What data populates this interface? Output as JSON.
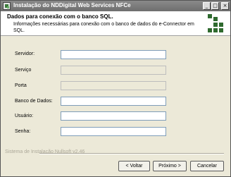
{
  "window": {
    "title": "Instalação do NDDigital Web Services NFCe",
    "controls": {
      "minimize": "_",
      "maximize": "□",
      "close": "×"
    }
  },
  "header": {
    "title": "Dados para conexão com o banco SQL.",
    "subtitle": "Informações necessárias para conexão com o banco de dados do e-Connector em SQL."
  },
  "form": {
    "fields": [
      {
        "label": "Servidor:",
        "value": "",
        "enabled": true
      },
      {
        "label": "Serviço",
        "value": "",
        "enabled": false
      },
      {
        "label": "Porta",
        "value": "",
        "enabled": false
      },
      {
        "label": "Banco de Dados:",
        "value": "",
        "enabled": true
      },
      {
        "label": "Usuário:",
        "value": "",
        "enabled": true
      },
      {
        "label": "Senha:",
        "value": "",
        "enabled": true
      }
    ]
  },
  "footer": {
    "installer_name": "Sistema de Instalação Nullsoft v2.46",
    "back_label": "< Voltar",
    "next_label": "Próximo >",
    "cancel_label": "Cancelar"
  },
  "colors": {
    "dialog_bg": "#ece9d8",
    "titlebar": "#7c7c7c",
    "logo_green": "#2f6a2f"
  }
}
